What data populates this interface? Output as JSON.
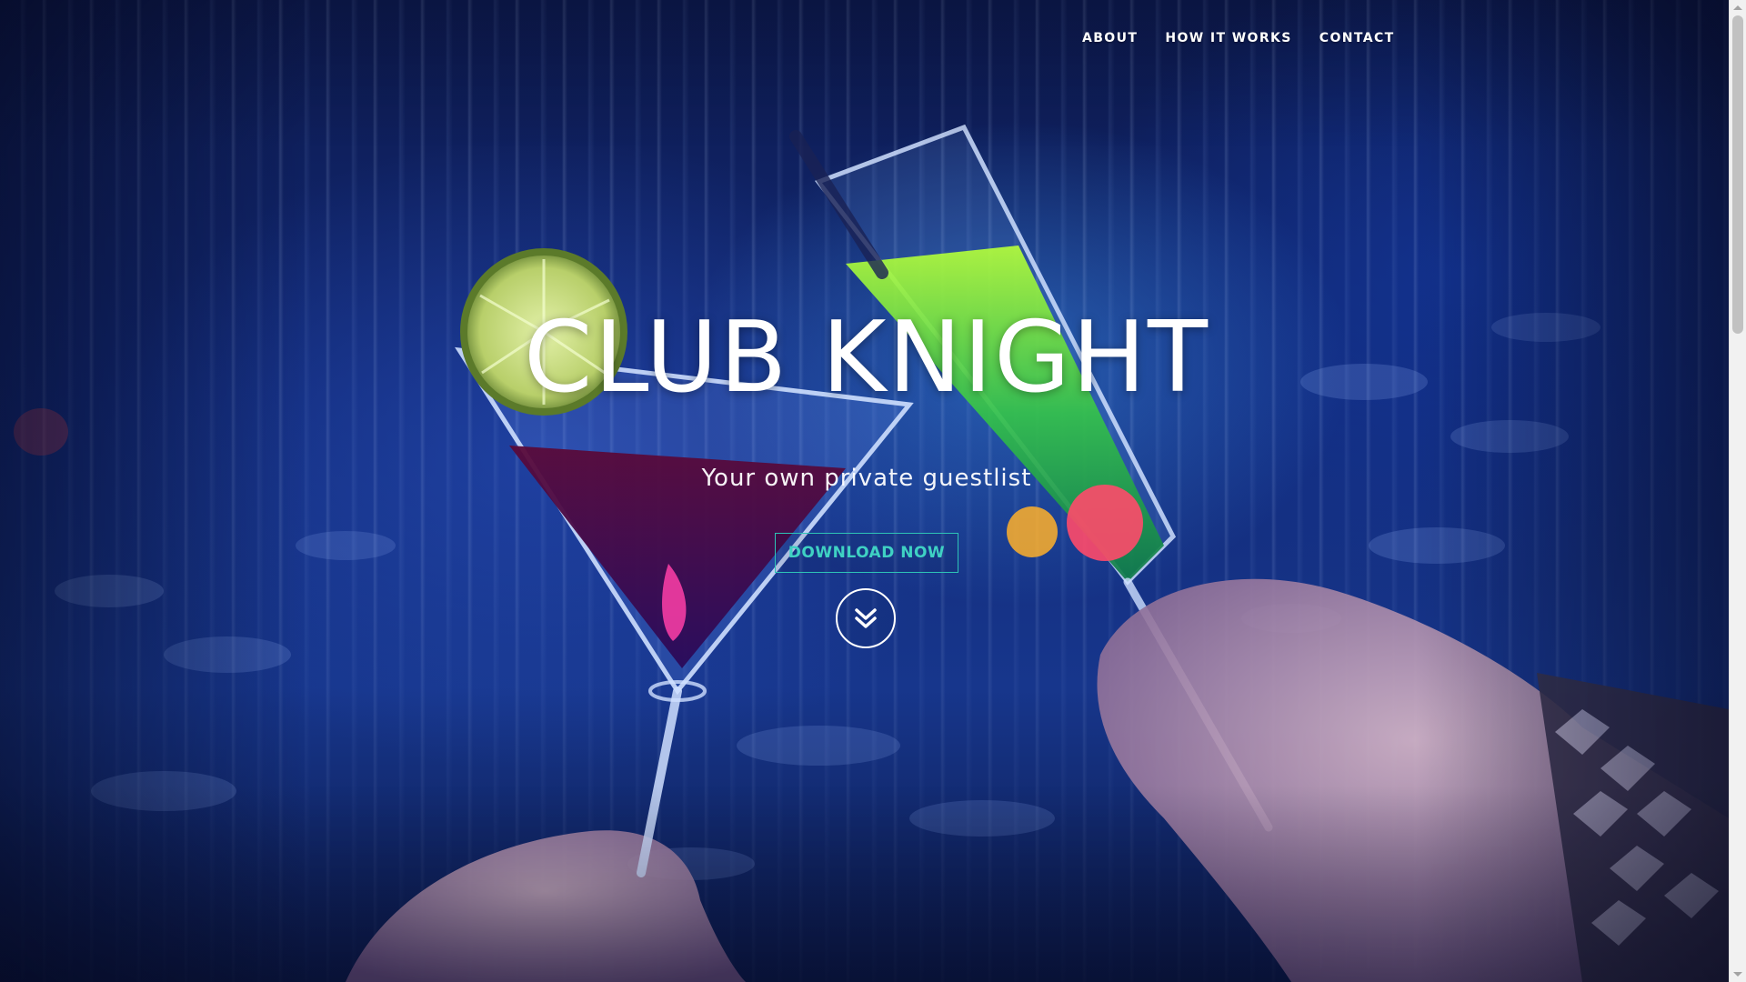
{
  "nav": {
    "items": [
      {
        "label": "ABOUT"
      },
      {
        "label": "HOW IT WORKS"
      },
      {
        "label": "CONTACT"
      }
    ]
  },
  "hero": {
    "title": "CLUB KNIGHT",
    "subtitle": "Your own private guestlist",
    "cta_label": "DOWNLOAD NOW",
    "scroll_icon": "double-chevron-down-icon"
  },
  "colors": {
    "accent": "#2ec4b6",
    "text": "#ffffff",
    "background": "#122a78"
  }
}
